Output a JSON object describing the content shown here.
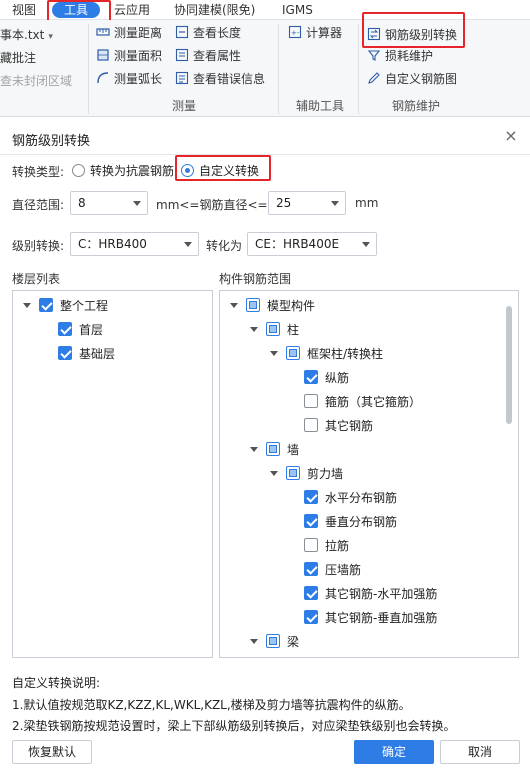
{
  "menu": {
    "tabs": [
      "视图",
      "工具",
      "云应用",
      "协同建模(限免)",
      "IGMS"
    ]
  },
  "ribbon": {
    "left_items": [
      "事本.txt",
      "藏批注",
      "查未封闭区域"
    ],
    "measure": {
      "items": [
        "测量距离",
        "测量面积",
        "测量弧长",
        "查看长度",
        "查看属性",
        "查看错误信息"
      ],
      "label": "测量"
    },
    "aux": {
      "items": [
        "计算器"
      ],
      "label": "辅助工具"
    },
    "rebar_maint": {
      "items": [
        "钢筋级别转换",
        "损耗维护",
        "自定义钢筋图"
      ],
      "label": "钢筋维护"
    }
  },
  "dialog": {
    "title": "钢筋级别转换",
    "close": "×",
    "type_label": "转换类型:",
    "type_options": [
      "转换为抗震钢筋",
      "自定义转换"
    ],
    "diameter_label": "直径范围:",
    "diameter_from": "8",
    "diameter_middle": "mm<=钢筋直径<=",
    "diameter_to": "25",
    "diameter_unit": "mm",
    "grade_label": "级别转换:",
    "grade_from": "C：HRB400",
    "convert_to_label": "转化为",
    "grade_to": "CE：HRB400E",
    "floor_list_title": "楼层列表",
    "component_title": "构件钢筋范围",
    "floors": [
      "整个工程",
      "首层",
      "基础层"
    ],
    "components": {
      "root": "模型构件",
      "col": "柱",
      "col_sub": "框架柱/转换柱",
      "col_items": [
        "纵筋",
        "箍筋（其它箍筋）",
        "其它钢筋"
      ],
      "wall": "墙",
      "wall_sub": "剪力墙",
      "wall_items": [
        "水平分布钢筋",
        "垂直分布钢筋",
        "拉筋",
        "压墙筋",
        "其它钢筋-水平加强筋",
        "其它钢筋-垂直加强筋"
      ],
      "beam": "梁"
    },
    "notes": {
      "title": "自定义转换说明:",
      "line1": "1.默认值按规范取KZ,KZZ,KL,WKL,KZL,楼梯及剪力墙等抗震构件的纵筋。",
      "line2": "2.梁垫铁钢筋按规范设置时，梁上下部纵筋级别转换后，对应梁垫铁级别也会转换。"
    },
    "buttons": {
      "restore": "恢复默认",
      "ok": "确定",
      "cancel": "取消"
    }
  },
  "colors": {
    "accent": "#2e7ce6",
    "highlight": "#e5252a"
  }
}
